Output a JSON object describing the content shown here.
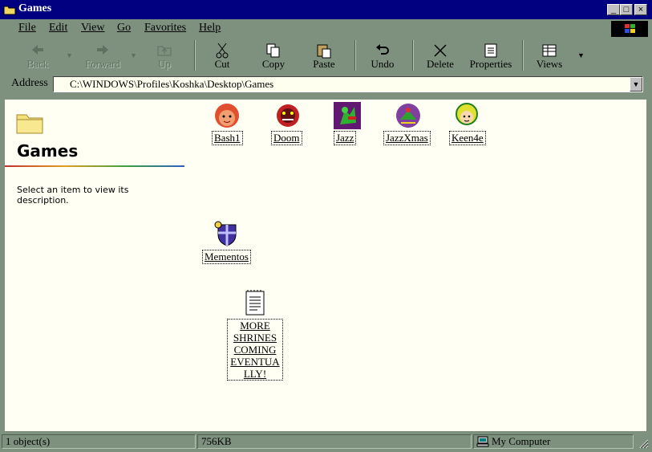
{
  "window": {
    "title": "Games",
    "min_symbol": "_",
    "max_symbol": "□",
    "close_symbol": "×"
  },
  "menu": [
    "File",
    "Edit",
    "View",
    "Go",
    "Favorites",
    "Help"
  ],
  "toolbar": {
    "back": "Back",
    "forward": "Forward",
    "up": "Up",
    "cut": "Cut",
    "copy": "Copy",
    "paste": "Paste",
    "undo": "Undo",
    "delete": "Delete",
    "properties": "Properties",
    "views": "Views"
  },
  "address": {
    "label": "Address",
    "value": "C:\\WINDOWS\\Profiles\\Koshka\\Desktop\\Games"
  },
  "left_pane": {
    "folder_name": "Games",
    "description": "Select an item to view its description."
  },
  "files": [
    {
      "name": "Bash1",
      "icon": "bash1-icon"
    },
    {
      "name": "Doom",
      "icon": "doom-icon"
    },
    {
      "name": "Jazz",
      "icon": "jazz-icon"
    },
    {
      "name": "JazzXmas",
      "icon": "jazzxmas-icon"
    },
    {
      "name": "Keen4e",
      "icon": "keen4e-icon"
    },
    {
      "name": "Mementos",
      "icon": "shield-icon"
    },
    {
      "name": "MORE SHRINES COMING EVENTUALLY!",
      "icon": "text-document-icon"
    }
  ],
  "note_lines": [
    "MORE",
    "SHRINES",
    "COMING",
    "EVENTUA",
    "LLY!"
  ],
  "status": {
    "objects": "1 object(s)",
    "size": "756KB",
    "location": "My Computer"
  },
  "colors": {
    "title_bar": "#000080",
    "chrome": "#7e917f",
    "pane_bg": "#fffff4"
  }
}
